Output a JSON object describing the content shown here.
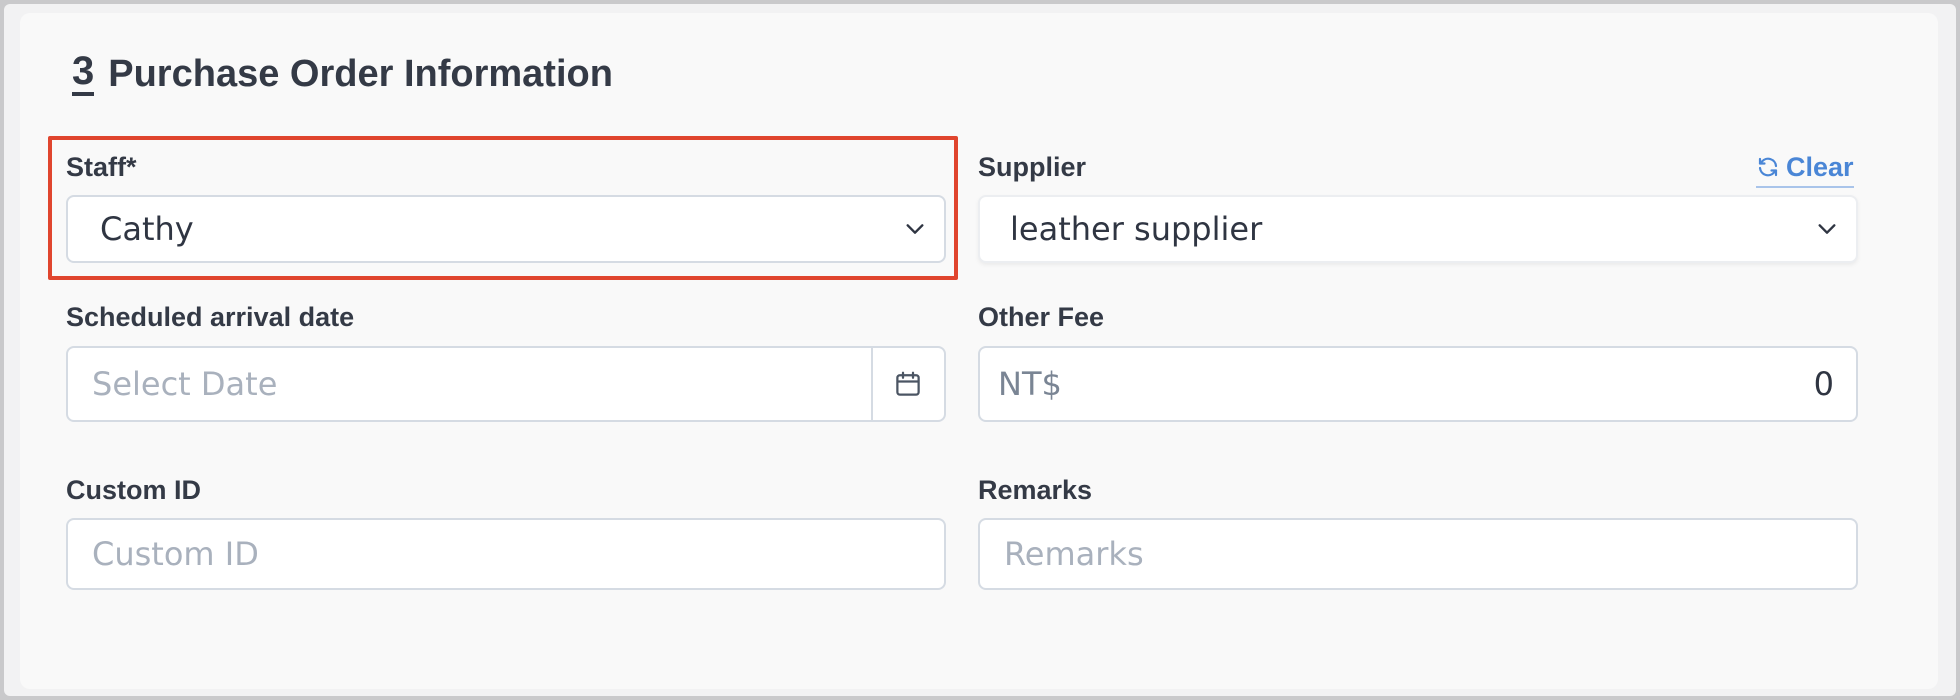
{
  "section": {
    "number": "3",
    "title": "Purchase Order Information"
  },
  "staff": {
    "label": "Staff*",
    "value": "Cathy"
  },
  "supplier": {
    "label": "Supplier",
    "value": "leather supplier",
    "clear_label": "Clear"
  },
  "arrival": {
    "label": "Scheduled arrival date",
    "placeholder": "Select Date"
  },
  "other_fee": {
    "label": "Other Fee",
    "currency": "NT$",
    "value": "0"
  },
  "custom_id": {
    "label": "Custom ID",
    "placeholder": "Custom ID"
  },
  "remarks": {
    "label": "Remarks",
    "placeholder": "Remarks"
  },
  "colors": {
    "highlight": "#e0452e",
    "link": "#4a86d6",
    "text": "#343a46",
    "border": "#d5dbe3"
  },
  "icons": [
    "chevron-down-icon",
    "refresh-icon",
    "calendar-icon"
  ]
}
